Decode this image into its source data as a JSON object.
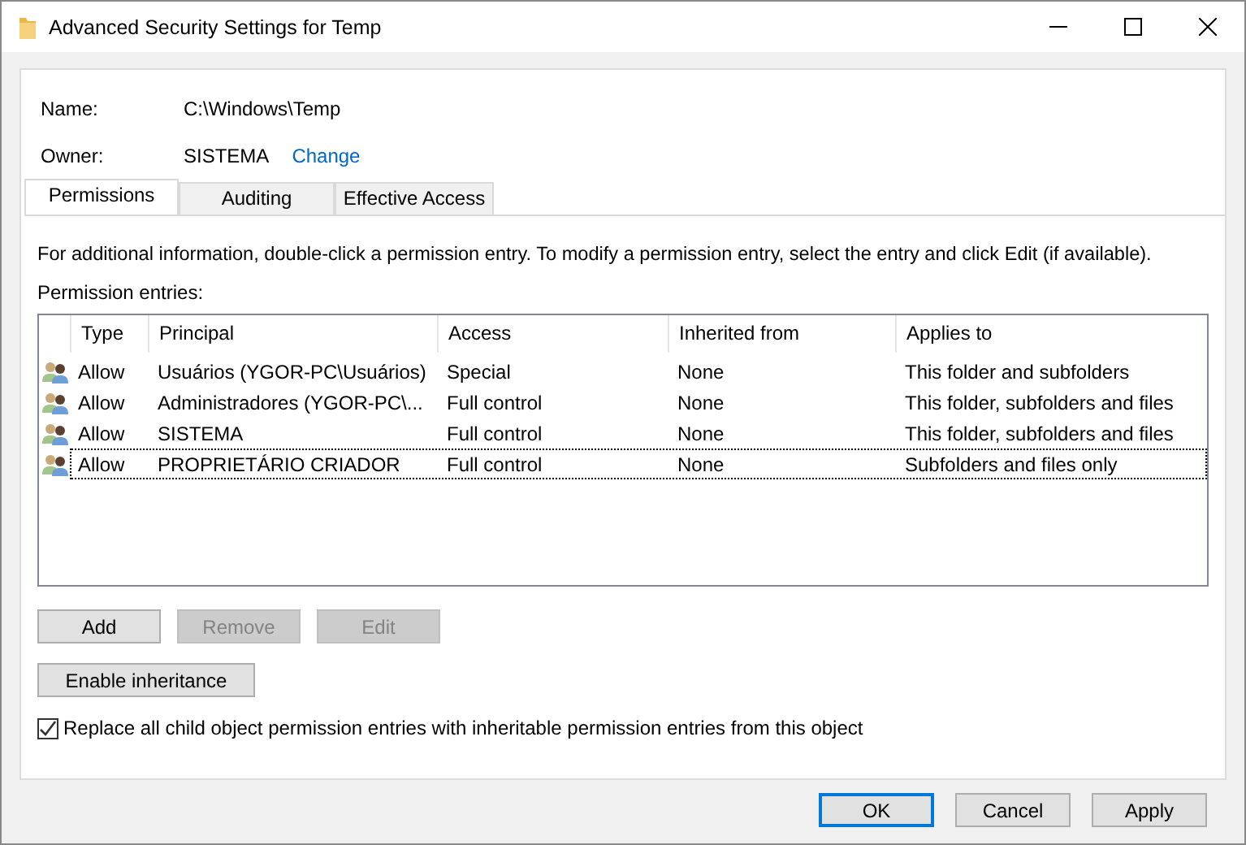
{
  "window": {
    "title": "Advanced Security Settings for Temp"
  },
  "name_field": {
    "label": "Name:",
    "value": "C:\\Windows\\Temp"
  },
  "owner_field": {
    "label": "Owner:",
    "value": "SISTEMA",
    "link": "Change"
  },
  "tabs": [
    {
      "label": "Permissions",
      "selected": true
    },
    {
      "label": "Auditing",
      "selected": false
    },
    {
      "label": "Effective Access",
      "selected": false
    }
  ],
  "info_text": "For additional information, double-click a permission entry. To modify a permission entry, select the entry and click Edit (if available).",
  "entries_label": "Permission entries:",
  "table": {
    "columns": [
      "Type",
      "Principal",
      "Access",
      "Inherited from",
      "Applies to"
    ],
    "rows": [
      {
        "cells": [
          "Allow",
          "Usuários (YGOR-PC\\Usuários)",
          "Special",
          "None",
          "This folder and subfolders"
        ],
        "focused": false
      },
      {
        "cells": [
          "Allow",
          "Administradores (YGOR-PC\\...",
          "Full control",
          "None",
          "This folder, subfolders and files"
        ],
        "focused": false
      },
      {
        "cells": [
          "Allow",
          "SISTEMA",
          "Full control",
          "None",
          "This folder, subfolders and files"
        ],
        "focused": false
      },
      {
        "cells": [
          "Allow",
          "PROPRIETÁRIO CRIADOR",
          "Full control",
          "None",
          "Subfolders and files only"
        ],
        "focused": true
      }
    ]
  },
  "entry_buttons": [
    {
      "label": "Add",
      "disabled": false
    },
    {
      "label": "Remove",
      "disabled": true
    },
    {
      "label": "Edit",
      "disabled": true
    }
  ],
  "inheritance_button": {
    "label": "Enable inheritance",
    "disabled": false
  },
  "replace_checkbox": {
    "label": "Replace all child object permission entries with inheritable permission entries from this object",
    "checked": true
  },
  "footer_buttons": [
    {
      "label": "OK",
      "default": true
    },
    {
      "label": "Cancel",
      "default": false
    },
    {
      "label": "Apply",
      "default": false
    }
  ]
}
